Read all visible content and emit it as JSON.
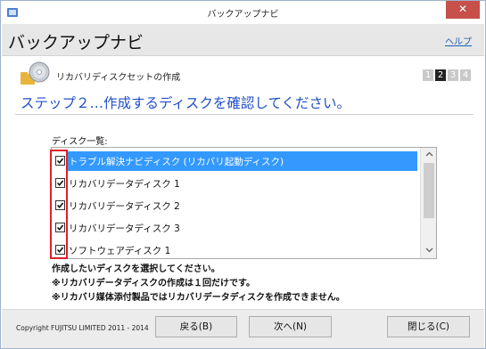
{
  "window": {
    "title": "バックアップナビ",
    "close_glyph": "✕"
  },
  "header": {
    "app_name": "バックアップナビ",
    "help_label": "ヘルプ"
  },
  "section": {
    "title": "リカバリディスクセットの作成"
  },
  "stepper": {
    "steps": [
      "1",
      "2",
      "3",
      "4"
    ],
    "current": 2
  },
  "step_heading": "ステップ２…作成するディスクを確認してください。",
  "disc_list": {
    "label": "ディスク一覧:",
    "items": [
      {
        "label": "トラブル解決ナビディスク (リカバリ起動ディスク)",
        "checked": true,
        "selected": true
      },
      {
        "label": "リカバリデータディスク 1",
        "checked": true,
        "selected": false
      },
      {
        "label": "リカバリデータディスク 2",
        "checked": true,
        "selected": false
      },
      {
        "label": "リカバリデータディスク 3",
        "checked": true,
        "selected": false
      },
      {
        "label": "ソフトウェアディスク 1",
        "checked": true,
        "selected": false
      }
    ]
  },
  "notes": [
    "作成したいディスクを選択してください。",
    "※リカバリデータディスクの作成は１回だけです。",
    "※リカバリ媒体添付製品ではリカバリデータディスクを作成できません。"
  ],
  "footer": {
    "copyright": "Copyright FUJITSU LIMITED 2011 - 2014",
    "back_label": "戻る(B)",
    "next_label": "次へ(N)",
    "close_label": "閉じる(C)"
  },
  "colors": {
    "accent": "#1f4fc8",
    "selection": "#3399ff",
    "highlight": "#e0202a",
    "close": "#c7504a"
  },
  "icons": [
    "app-icon",
    "disc-icon",
    "checkbox-check-icon",
    "scroll-up-arrow-icon",
    "scroll-down-arrow-icon"
  ]
}
